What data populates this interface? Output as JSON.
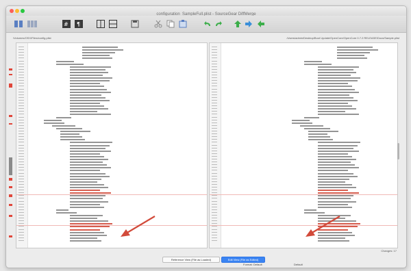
{
  "window": {
    "title": "configuration_SampleFull.plist - SourceGear DiffMerge"
  },
  "paths": {
    "left": "/Volumes/OSX/Files/config.plist",
    "right": "/Users/admin/Desktop/Boot Update/OpenCore/OpenCore 0.7.2 RELEASE/Docs/Sample.plist"
  },
  "status": {
    "changes": "Changes: 17"
  },
  "buttons": {
    "reference_label": "Reference View (File as Loaded)",
    "edit_label": "Edit View (File as Edited)"
  },
  "footer": {
    "encoding_left": "Format: Default",
    "encoding_right": "Default"
  },
  "colors": {
    "diff_red": "#d24a3a",
    "accent_blue": "#3b84f2"
  }
}
